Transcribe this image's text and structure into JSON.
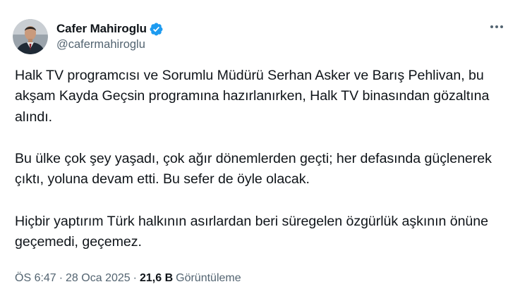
{
  "author": {
    "display_name": "Cafer Mahiroglu",
    "handle": "@cafermahiroglu",
    "verified": true,
    "verified_color": "#1d9bf0"
  },
  "tweet": {
    "paragraphs": [
      "Halk TV programcısı ve Sorumlu Müdürü Serhan Asker ve Barış Pehlivan, bu akşam Kayda Geçsin programına hazırlanırken, Halk TV binasından gözaltına alındı.",
      "Bu ülke çok şey yaşadı, çok ağır dönemlerden geçti; her defasında güçlenerek çıktı, yoluna devam etti. Bu sefer de öyle olacak.",
      "Hiçbir yaptırım Türk halkının asırlardan beri süregelen özgürlük aşkının önüne geçemedi, geçemez."
    ]
  },
  "meta": {
    "time": "ÖS 6:47",
    "separator": "·",
    "date": "28 Oca 2025",
    "views_count": "21,6 B",
    "views_label": "Görüntüleme"
  },
  "icons": {
    "more": "more-horizontal-icon",
    "verified": "verified-badge-icon"
  },
  "colors": {
    "text_primary": "#0f1419",
    "text_secondary": "#536471",
    "background": "#ffffff"
  }
}
